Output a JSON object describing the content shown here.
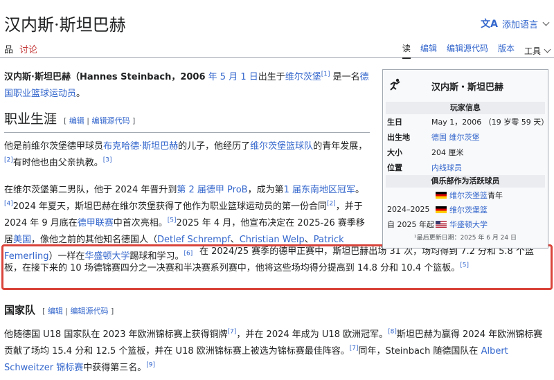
{
  "page": {
    "title": "汉内斯·斯坦巴赫",
    "add_language": "添加语言"
  },
  "tabs": {
    "article": "品",
    "talk": "讨论",
    "read": "读",
    "edit": "编辑",
    "edit_source": "编辑源代码",
    "history": "版本",
    "tools": "工具"
  },
  "intro": {
    "name": "汉内斯·斯坦巴赫（Hannes Steinbach，2006",
    "date_link": "年 5 月 1 日",
    "born_in": "出生于",
    "birthplace_link": "维尔茨堡",
    "ref": "[1]",
    "is_a": " 是一名",
    "nationality_link": "德国职业篮球运动员",
    "end": "。"
  },
  "section1": {
    "title": "职业生涯",
    "edit_open": "[ ",
    "edit": "编辑",
    "edit_sep": " | ",
    "edit_source": "编辑源代码",
    "edit_close": " ]"
  },
  "para1": {
    "t1": "他是前维尔茨堡德甲球员",
    "father_link": "布克哈德·斯坦巴赫",
    "t2": "的儿子，他经历了",
    "club_link": "维尔茨堡篮球队",
    "t3": "的青年发展，",
    "ref2": "[2]",
    "t4": "有时他也由父亲执教。",
    "ref3": "[3]"
  },
  "para2": {
    "t1": "在维尔茨堡第二男队，他于 2024 年晋升到",
    "proB_link": "第 2 届德甲 ProB",
    "t2": "，成为第",
    "se_link": "1 届东南地区冠军",
    "t3": "。",
    "ref4": "[4]",
    "t4": "2024 年夏天，斯坦巴赫在维尔茨堡获得了他作为职业篮球运动员的第一份合同",
    "ref2": "[2]",
    "t5": "，并于 2024 年 9 月底在",
    "bbl_link": "德甲联赛",
    "t6": "中首次亮相。",
    "ref5": "[5]",
    "t7": "2025 年 4 月，他宣布决定在 2025-26 赛季移居",
    "usa_link": "美国",
    "t8": "，像他之前的其他知名德国人（",
    "p1": "Detlef Schrempf",
    "sep1": "、",
    "p2": "Christian Welp",
    "sep2": "、",
    "p3": "Patrick Femerling",
    "t9": "）一样在",
    "uw_link": "华盛顿大学",
    "t10": "踢球和学习。",
    "ref6": "[6]",
    "t11": "在 2024/25 赛季的德甲正赛中，斯坦巴赫出场 31 次，场均得到 7.2 分和 5.8 个篮板，在接下来的 10 场德锦赛四分之一决赛和半决赛系列赛中，他将这些场均得分提高到 14.8 分和 10.4 个篮板。",
    "ref5b": "[5]"
  },
  "section2": {
    "title": "国家队",
    "edit_open": "[ ",
    "edit": "编辑",
    "edit_sep": " | ",
    "edit_source": "编辑源代码",
    "edit_close": " ]"
  },
  "para3": {
    "t1": "他随德国 U18 国家队在 2023 年欧洲锦标赛上获得铜牌",
    "ref7": "[7]",
    "t2": "，并在 2024 年成为 U18 欧洲冠军。",
    "ref8": "[8]",
    "t3": "斯坦巴赫为赢得 2024 年欧洲锦标赛贡献了场均 15.4 分和 12.5 个篮板，并在 U18 欧洲锦标赛上被选为锦标赛最佳阵容。",
    "ref7b": "[7]",
    "t4": "同年，Steinbach 随德国队在",
    "tourn_link": "Albert Schweitzer 锦标赛",
    "t5": "中获得第三名。",
    "ref9": "[9]"
  },
  "infobox": {
    "name": "汉内斯・斯坦巴赫",
    "info_header": "玩家信息",
    "rows": [
      {
        "label": "生日",
        "value": "May 1，2006 （19 岁零 59 天）"
      },
      {
        "label": "出生地",
        "value": "德国 维尔茨堡"
      },
      {
        "label": "大小",
        "value": "204 厘米"
      },
      {
        "label": "位置",
        "value": "内线球员"
      }
    ],
    "clubs_header": "俱乐部作为活跃球员",
    "clubs": [
      {
        "years": "",
        "team": "维尔茨堡篮",
        "suffix": "青年"
      },
      {
        "years": "2024–2025",
        "team": "维尔茨堡篮",
        "suffix": ""
      },
      {
        "years": "自 2025 年起",
        "team": "华盛顿大学",
        "suffix": ""
      }
    ],
    "footnote": "¹最后更新日期：2025 年 6 月 24 日"
  }
}
